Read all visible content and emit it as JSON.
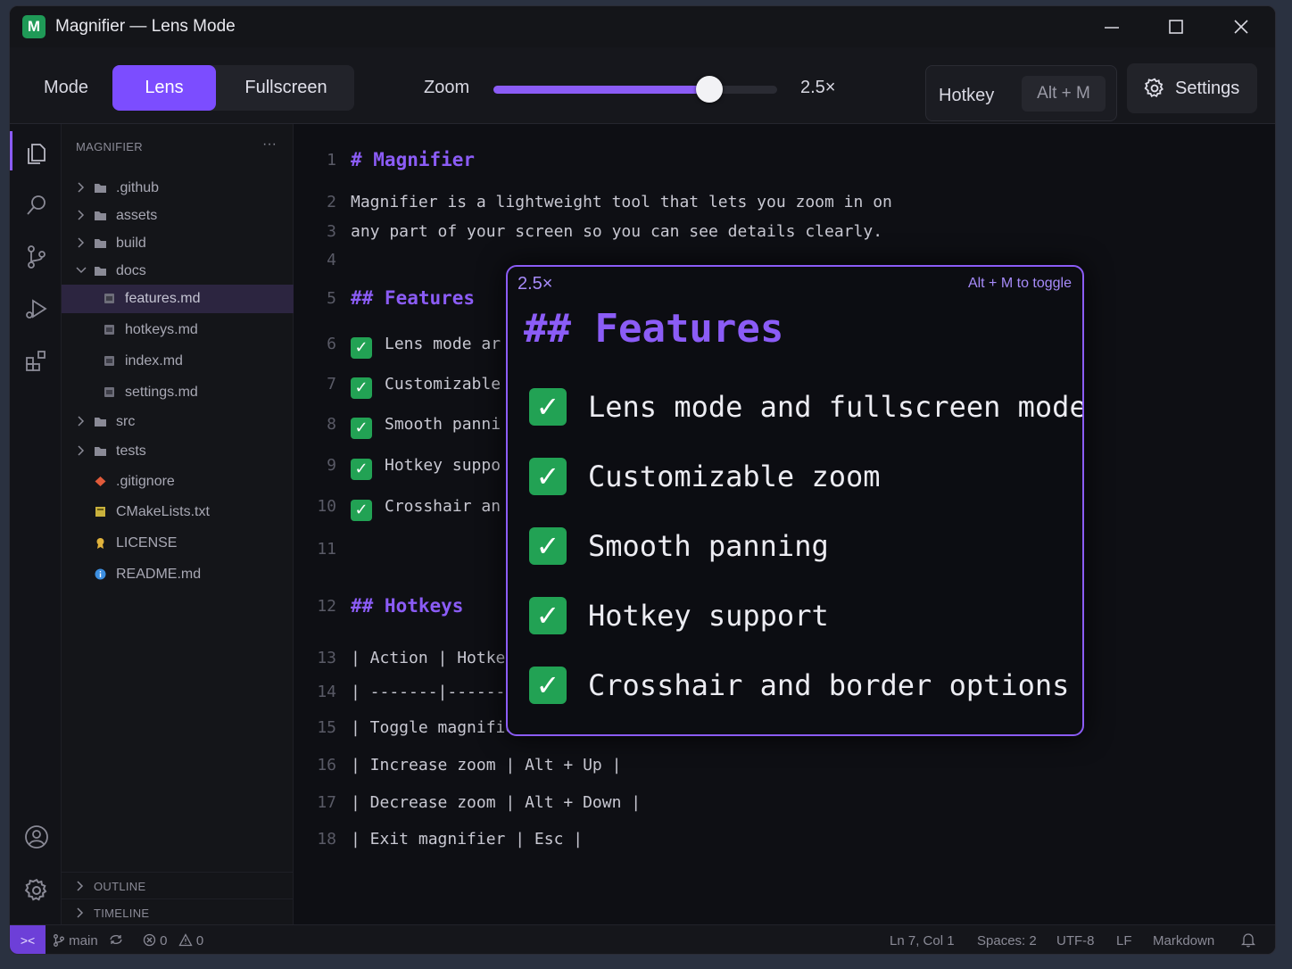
{
  "window": {
    "app_letter": "M",
    "title": "Magnifier — Lens Mode"
  },
  "toolbar": {
    "mode_label": "Mode",
    "modes": [
      "Lens",
      "Fullscreen"
    ],
    "active_mode": "Lens",
    "zoom_label": "Zoom",
    "zoom_value_text": "2.5×",
    "zoom_fraction": 0.76,
    "hotkey_label": "Hotkey",
    "hotkey_value": "Alt + M",
    "settings_label": "Settings"
  },
  "sidebar": {
    "header": "MAGNIFIER",
    "more": "···",
    "tree": [
      {
        "name": ".github",
        "type": "folder",
        "expanded": false,
        "depth": 0
      },
      {
        "name": "assets",
        "type": "folder",
        "expanded": false,
        "depth": 0
      },
      {
        "name": "build",
        "type": "folder",
        "expanded": false,
        "depth": 0
      },
      {
        "name": "docs",
        "type": "folder",
        "expanded": true,
        "depth": 0
      },
      {
        "name": "features.md",
        "type": "md",
        "depth": 1,
        "selected": true
      },
      {
        "name": "hotkeys.md",
        "type": "md",
        "depth": 1
      },
      {
        "name": "index.md",
        "type": "md",
        "depth": 1
      },
      {
        "name": "settings.md",
        "type": "md",
        "depth": 1
      },
      {
        "name": "src",
        "type": "folder",
        "expanded": false,
        "depth": 0
      },
      {
        "name": "tests",
        "type": "folder",
        "expanded": false,
        "depth": 0
      },
      {
        "name": ".gitignore",
        "type": "git",
        "depth": 0
      },
      {
        "name": "CMakeLists.txt",
        "type": "cmake",
        "depth": 0
      },
      {
        "name": "LICENSE",
        "type": "license",
        "depth": 0
      },
      {
        "name": "README.md",
        "type": "info",
        "depth": 0
      }
    ],
    "sections": [
      "OUTLINE",
      "TIMELINE"
    ]
  },
  "editor": {
    "lines": [
      {
        "n": "1",
        "text": "# Magnifier",
        "kind": "heading"
      },
      {
        "n": "2",
        "text": "Magnifier is a lightweight tool that lets you zoom in on",
        "kind": "text"
      },
      {
        "n": "3",
        "text": "any part of your screen so you can see details clearly.",
        "kind": "text"
      },
      {
        "n": "4",
        "text": "",
        "kind": "text"
      },
      {
        "n": "5",
        "text": "## Features",
        "kind": "heading"
      },
      {
        "n": "6",
        "text": "Lens mode ar",
        "kind": "check"
      },
      {
        "n": "7",
        "text": "Customizable",
        "kind": "check"
      },
      {
        "n": "8",
        "text": "Smooth panni",
        "kind": "check"
      },
      {
        "n": "9",
        "text": "Hotkey suppo",
        "kind": "check"
      },
      {
        "n": "10",
        "text": "Crosshair an",
        "kind": "check"
      },
      {
        "n": "11",
        "text": "",
        "kind": "text"
      },
      {
        "n": "12",
        "text": "## Hotkeys",
        "kind": "heading"
      },
      {
        "n": "13",
        "text": "| Action | Hotkey",
        "kind": "text"
      },
      {
        "n": "14",
        "text": "| -------|--------",
        "kind": "text"
      },
      {
        "n": "15",
        "text": "| Toggle magnifier",
        "kind": "text"
      },
      {
        "n": "16",
        "text": "| Increase zoom | Alt + Up |",
        "kind": "text"
      },
      {
        "n": "17",
        "text": "| Decrease zoom | Alt + Down |",
        "kind": "text"
      },
      {
        "n": "18",
        "text": "| Exit magnifier | Esc |",
        "kind": "text"
      }
    ]
  },
  "lens": {
    "zoom_text": "2.5×",
    "hint": "Alt + M to toggle",
    "heading": "## Features",
    "check_glyph": "✓",
    "items": [
      "Lens mode and fullscreen mode",
      "Customizable zoom",
      "Smooth panning",
      "Hotkey support",
      "Crosshair and border options"
    ]
  },
  "statusbar": {
    "remote_glyph": "><",
    "branch": "main",
    "errors": "0",
    "warnings": "0",
    "position": "Ln 7, Col 1",
    "spaces": "Spaces: 2",
    "encoding": "UTF-8",
    "eol": "LF",
    "language": "Markdown"
  },
  "colors": {
    "accent": "#8b5cf6",
    "check": "#22a254",
    "background": "#0f1016"
  },
  "icons": {
    "activity": [
      "explorer-icon",
      "search-icon",
      "source-control-icon",
      "run-debug-icon",
      "extensions-icon",
      "account-icon",
      "settings-gear-icon"
    ]
  }
}
